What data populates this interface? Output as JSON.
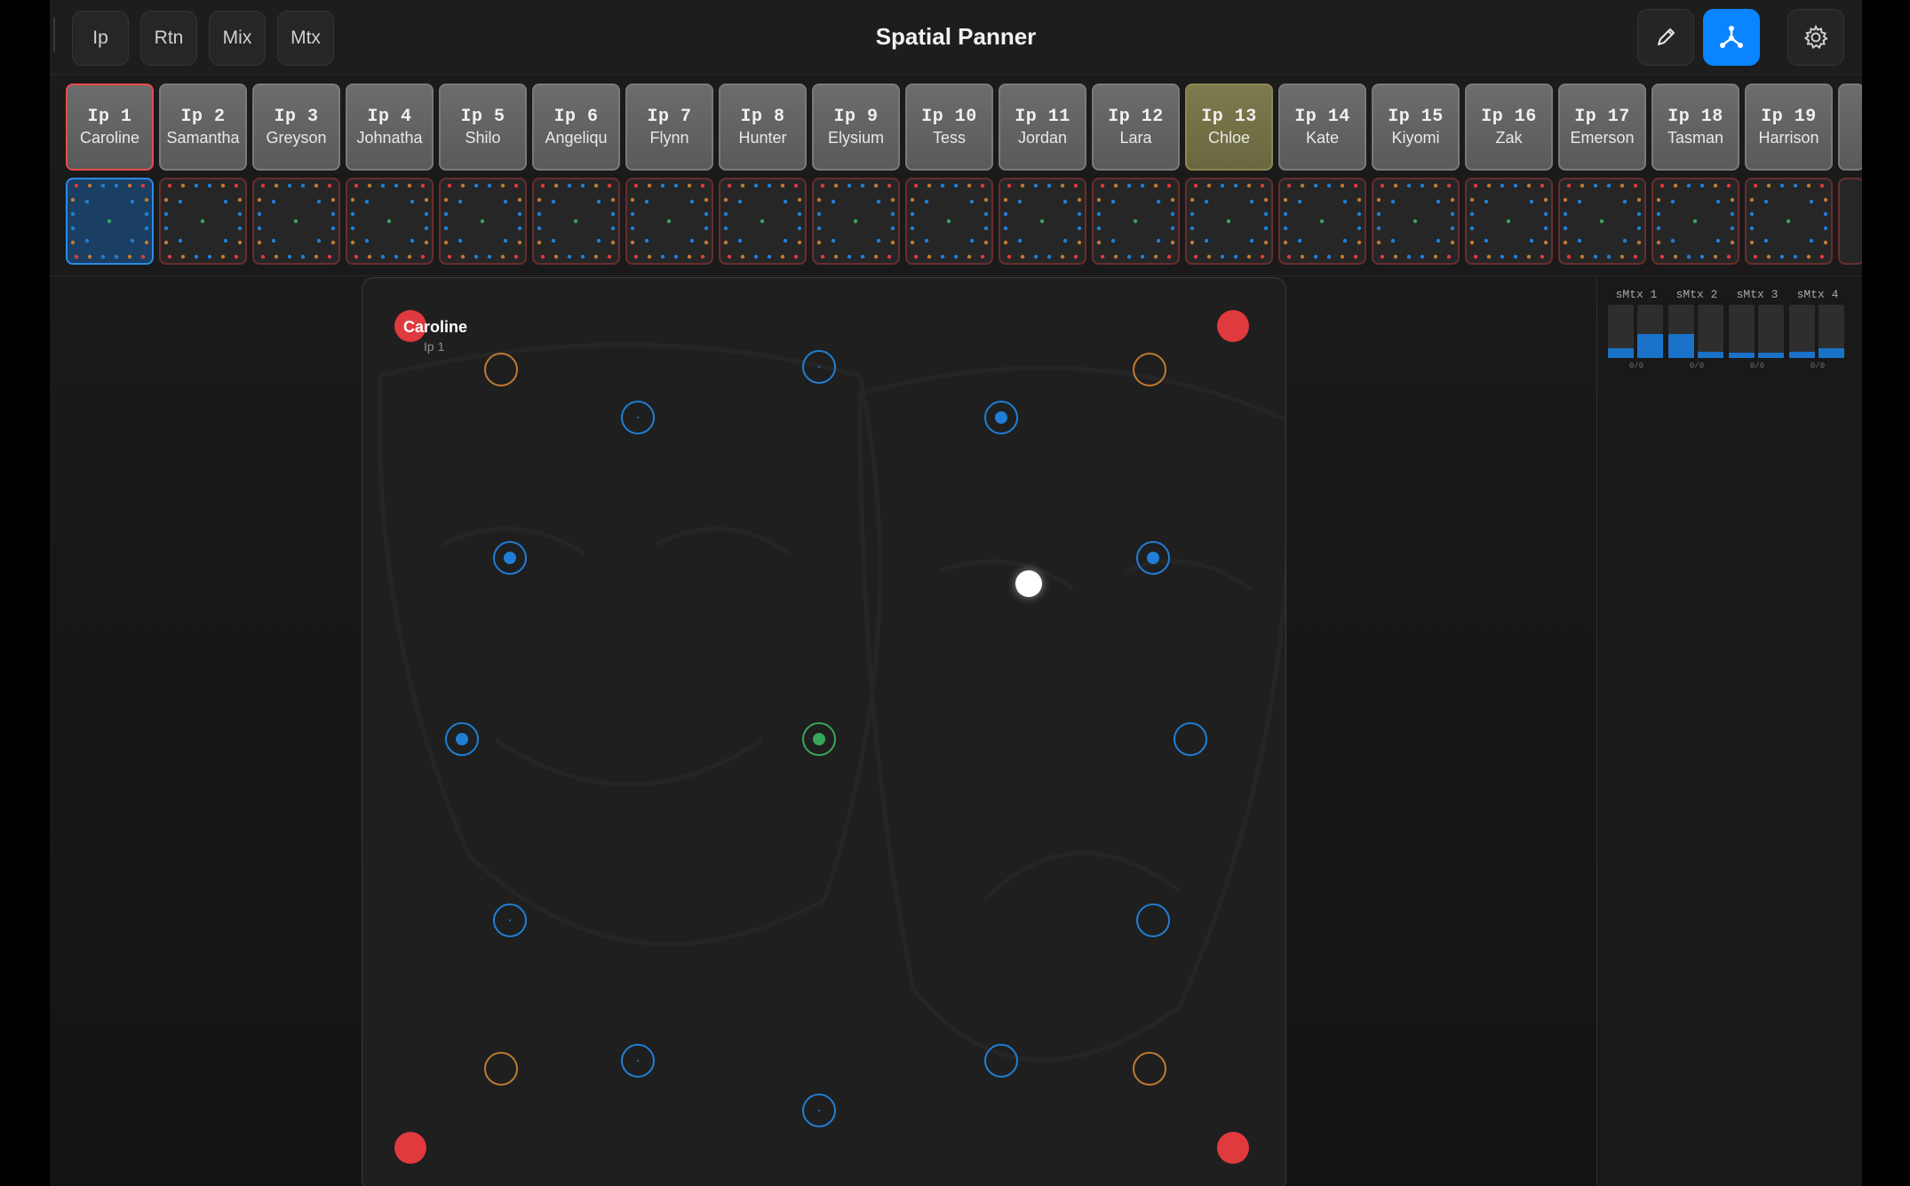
{
  "header": {
    "title": "Spatial Panner",
    "modes": [
      {
        "label": "Ip"
      },
      {
        "label": "Rtn"
      },
      {
        "label": "Mix"
      },
      {
        "label": "Mtx"
      }
    ],
    "tools": [
      "edit-pencil-icon",
      "spatial-network-icon",
      "gear-icon"
    ],
    "active_tool": "spatial-network-icon"
  },
  "channels": [
    {
      "num": "Ip 1",
      "name": "Caroline"
    },
    {
      "num": "Ip 2",
      "name": "Samantha"
    },
    {
      "num": "Ip 3",
      "name": "Greyson"
    },
    {
      "num": "Ip 4",
      "name": "Johnatha"
    },
    {
      "num": "Ip 5",
      "name": "Shilo"
    },
    {
      "num": "Ip 6",
      "name": "Angeliqu"
    },
    {
      "num": "Ip 7",
      "name": "Flynn"
    },
    {
      "num": "Ip 8",
      "name": "Hunter"
    },
    {
      "num": "Ip 9",
      "name": "Elysium"
    },
    {
      "num": "Ip 10",
      "name": "Tess"
    },
    {
      "num": "Ip 11",
      "name": "Jordan"
    },
    {
      "num": "Ip 12",
      "name": "Lara"
    },
    {
      "num": "Ip 13",
      "name": "Chloe"
    },
    {
      "num": "Ip 14",
      "name": "Kate"
    },
    {
      "num": "Ip 15",
      "name": "Kiyomi"
    },
    {
      "num": "Ip 16",
      "name": "Zak"
    },
    {
      "num": "Ip 17",
      "name": "Emerson"
    },
    {
      "num": "Ip 18",
      "name": "Tasman"
    },
    {
      "num": "Ip 19",
      "name": "Harrison"
    }
  ],
  "selected_channel": "Ip 1",
  "highlighted_channel": "Ip 13",
  "panner": {
    "source_name": "Caroline",
    "source_id": "Ip 1"
  },
  "matrix_meters": [
    {
      "label": "sMtx 1",
      "levels": [
        0.18,
        0.45
      ],
      "value": "0/0"
    },
    {
      "label": "sMtx 2",
      "levels": [
        0.45,
        0.12
      ],
      "value": "0/0"
    },
    {
      "label": "sMtx 3",
      "levels": [
        0.1,
        0.1
      ],
      "value": "0/0"
    },
    {
      "label": "sMtx 4",
      "levels": [
        0.12,
        0.18
      ],
      "value": "0/0"
    }
  ],
  "colors": {
    "accent": "#0a84ff",
    "speaker_blue": "#1f7fd6",
    "speaker_orange": "#c07a32",
    "speaker_green": "#3aa65a",
    "corner_red": "#e0393e",
    "selected_border": "#e94b4b"
  }
}
